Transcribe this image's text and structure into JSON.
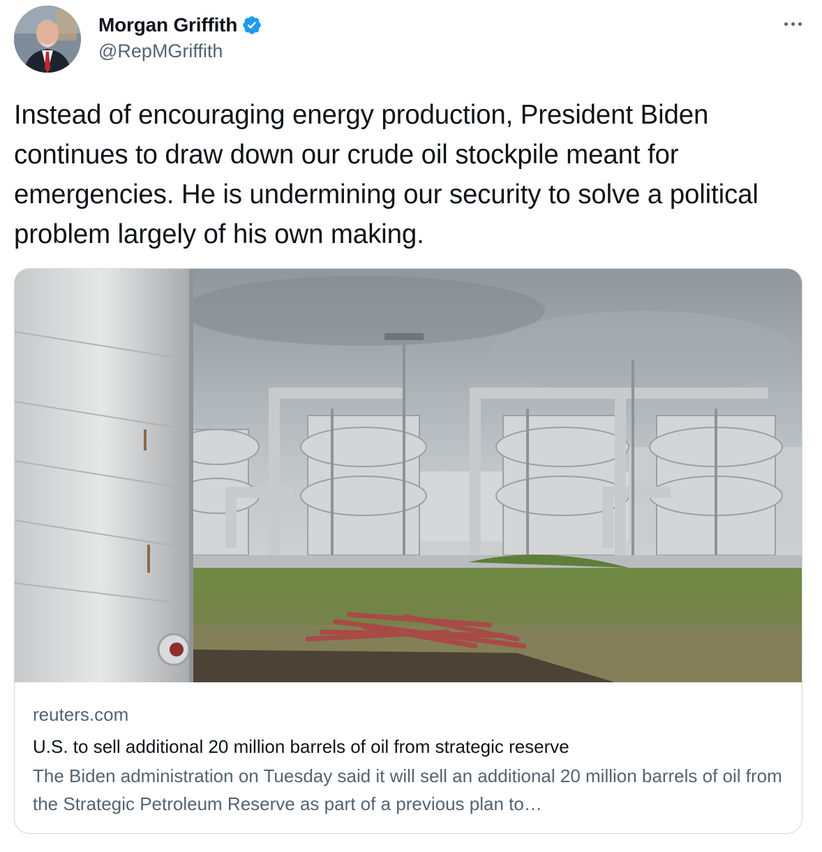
{
  "author": {
    "display_name": "Morgan Griffith",
    "handle": "@RepMGriffith",
    "verified": true,
    "avatar_icon": "profile-photo"
  },
  "tweet": {
    "text": "Instead of encouraging energy production, President Biden continues to draw down our crude oil stockpile meant for emergencies. He is undermining our security to solve a political problem largely of his own making."
  },
  "card": {
    "image_icon": "oil-storage-facility-photo",
    "domain": "reuters.com",
    "title": "U.S. to sell additional 20 million barrels of oil from strategic reserve",
    "description": "The Biden administration on Tuesday said it will sell an additional 20 million barrels of oil from the Strategic Petroleum Reserve as part of a previous plan to…"
  },
  "colors": {
    "text_primary": "#0f1419",
    "text_secondary": "#536471",
    "verified_blue": "#1d9bf0",
    "border": "#cfd9de"
  }
}
